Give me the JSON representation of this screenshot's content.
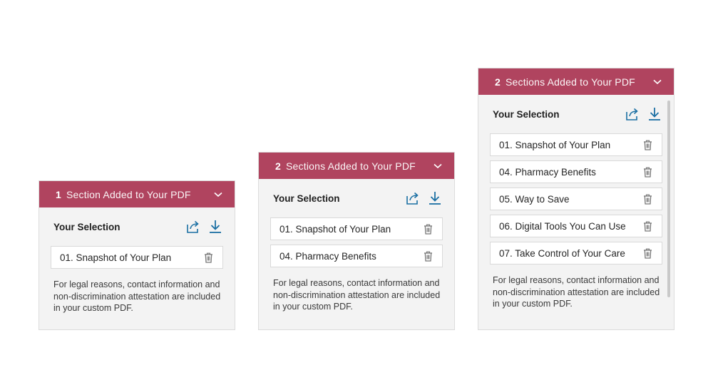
{
  "colors": {
    "header": "#b0445f",
    "icon_blue": "#1a6fa3",
    "panel_bg": "#f3f3f3"
  },
  "icons": {
    "share": "share-icon",
    "download": "download-icon",
    "delete": "trash-icon",
    "toggle": "chevron-down-icon"
  },
  "panels": [
    {
      "count": "1",
      "header_title": "Section Added to Your PDF",
      "selection_title": "Your Selection",
      "items": [
        "01. Snapshot of Your Plan"
      ],
      "legal": "For legal reasons, contact information and non-discrimination attestation are included in your custom PDF."
    },
    {
      "count": "2",
      "header_title": "Sections Added to Your PDF",
      "selection_title": "Your Selection",
      "items": [
        "01. Snapshot of Your Plan",
        "04. Pharmacy Benefits"
      ],
      "legal": "For legal reasons, contact information and non-discrimination attestation are included in your custom PDF."
    },
    {
      "count": "2",
      "header_title": "Sections Added to Your PDF",
      "selection_title": "Your Selection",
      "items": [
        "01. Snapshot of Your Plan",
        "04. Pharmacy Benefits",
        "05. Way to Save",
        "06. Digital Tools You Can Use",
        "07. Take Control of Your Care"
      ],
      "legal": "For legal reasons, contact information and non-discrimination attestation are included in your custom PDF."
    }
  ]
}
